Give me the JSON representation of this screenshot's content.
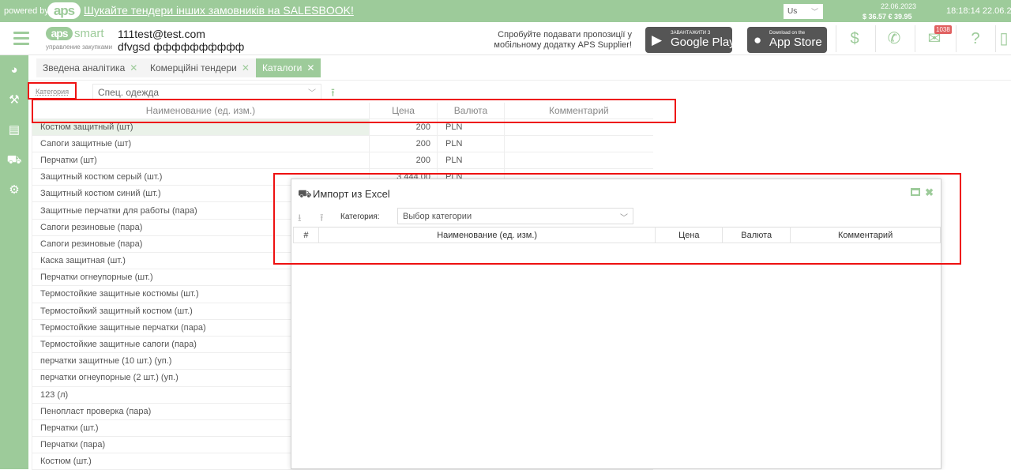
{
  "promo_bar": {
    "powered_by": "powered by",
    "logo": "aps",
    "link_text": "Шукайте тендери інших замовників на SALESBOOK!",
    "language": "Us",
    "date": "22.06.2023",
    "rates": "$ 36.57  € 39.95",
    "time": "18:18:14   22.06.2"
  },
  "header": {
    "brand_pill": "aps",
    "brand_name": "smart",
    "brand_sub": "управление закупками",
    "user_email": "111test@test.com",
    "user_name": "dfvgsd фффффффффф",
    "promo_text": "Спробуйте подавати пропозиції у мобільному додатку APS Supplier!",
    "google_play_small": "ЗАВАНТАЖИТИ З",
    "google_play_big": "Google Play",
    "app_store_small": "Download on the",
    "app_store_big": "App Store",
    "mail_badge": "1038",
    "icons": [
      "dollar-icon",
      "phone-icon",
      "mail-icon",
      "help-icon",
      "exit-icon"
    ]
  },
  "sidebar": {
    "icons": [
      "pie-chart-icon",
      "gavel-icon",
      "document-icon",
      "truck-icon",
      "settings-icon"
    ]
  },
  "tabs": [
    {
      "label": "Зведена аналітика"
    },
    {
      "label": "Комерційні тендери"
    },
    {
      "label": "Каталоги"
    }
  ],
  "filter": {
    "category_label": "Категория",
    "category_value": "Спец. одежда"
  },
  "catalog_table": {
    "headers": [
      "Наименование (ед. изм.)",
      "Цена",
      "Валюта",
      "Комментарий"
    ],
    "rows": [
      {
        "name": "Костюм защитный (шт)",
        "price": "200",
        "currency": "PLN"
      },
      {
        "name": "Сапоги защитные (шт)",
        "price": "200",
        "currency": "PLN"
      },
      {
        "name": "Перчатки (шт)",
        "price": "200",
        "currency": "PLN"
      },
      {
        "name": "Защитный костюм серый (шт.)",
        "price": "3 444.00",
        "currency": "PLN"
      },
      {
        "name": "Защитный костюм синий (шт.)",
        "price": "",
        "currency": ""
      },
      {
        "name": "Защитные перчатки для работы (пара)",
        "price": "",
        "currency": ""
      },
      {
        "name": "Сапоги резиновые (пара)",
        "price": "",
        "currency": ""
      },
      {
        "name": "Сапоги резиновые (пара)",
        "price": "",
        "currency": ""
      },
      {
        "name": "Каска защитная (шт.)",
        "price": "",
        "currency": ""
      },
      {
        "name": "Перчатки огнеупорные (шт.)",
        "price": "",
        "currency": ""
      },
      {
        "name": "Термостойкие защитные костюмы (шт.)",
        "price": "",
        "currency": ""
      },
      {
        "name": "Термостойкий защитный костюм (шт.)",
        "price": "",
        "currency": ""
      },
      {
        "name": "Термостойкие защитные перчатки (пара)",
        "price": "",
        "currency": ""
      },
      {
        "name": "Термостойкие защитные сапоги (пара)",
        "price": "",
        "currency": ""
      },
      {
        "name": "перчатки защитные (10 шт.) (уп.)",
        "price": "",
        "currency": ""
      },
      {
        "name": "перчатки огнеупорные (2 шт.) (уп.)",
        "price": "",
        "currency": ""
      },
      {
        "name": "123 (л)",
        "price": "",
        "currency": ""
      },
      {
        "name": "Пенопласт проверка (пара)",
        "price": "",
        "currency": ""
      },
      {
        "name": "Перчатки (шт.)",
        "price": "",
        "currency": ""
      },
      {
        "name": "Перчатки (пара)",
        "price": "",
        "currency": ""
      },
      {
        "name": "Костюм (шт.)",
        "price": "",
        "currency": ""
      }
    ]
  },
  "import_modal": {
    "title": "Импорт из Excel",
    "category_label": "Категория:",
    "category_placeholder": "Выбор категории",
    "headers": [
      "#",
      "Наименование (ед. изм.)",
      "Цена",
      "Валюта",
      "Комментарий"
    ]
  },
  "colors": {
    "accent": "#9dcb9a",
    "annotation": "#ee1111"
  }
}
